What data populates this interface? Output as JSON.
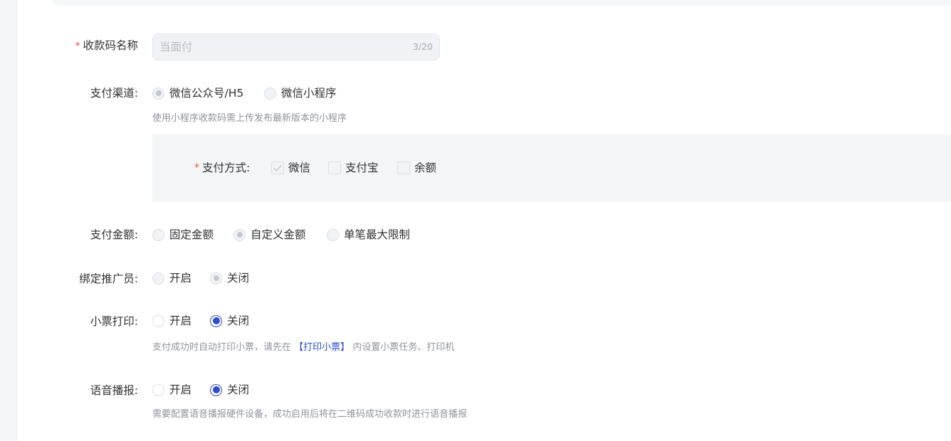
{
  "name_field": {
    "label": "收款码名称",
    "placeholder": "当面付",
    "counter": "3/20"
  },
  "pay_channel": {
    "label": "支付渠道:",
    "options": [
      "微信公众号/H5",
      "微信小程序"
    ],
    "selected": "微信公众号/H5",
    "hint": "使用小程序收款码需上传发布最新版本的小程序"
  },
  "pay_method": {
    "label": "支付方式:",
    "options": [
      {
        "label": "微信",
        "checked": true
      },
      {
        "label": "支付宝",
        "checked": false
      },
      {
        "label": "余额",
        "checked": false
      }
    ]
  },
  "pay_amount": {
    "label": "支付金额:",
    "options": [
      "固定金额",
      "自定义金额",
      "单笔最大限制"
    ],
    "selected": "自定义金额"
  },
  "bind_promoter": {
    "label": "绑定推广员:",
    "options": [
      "开启",
      "关闭"
    ],
    "selected": "关闭"
  },
  "receipt_print": {
    "label": "小票打印:",
    "options": [
      "开启",
      "关闭"
    ],
    "selected": "关闭",
    "hint_before": "支付成功时自动打印小票，请先在",
    "hint_link": "【打印小票】",
    "hint_after": "内设置小票任务、打印机"
  },
  "voice_broadcast": {
    "label": "语音播报:",
    "options": [
      "开启",
      "关闭"
    ],
    "selected": "关闭",
    "hint": "需要配置语音播报硬件设备，成功启用后将在二维码成功收款时进行语音播报"
  },
  "colors": {
    "accent": "#2d4bd6",
    "required": "#e4553b",
    "panel_bg": "#f4f5f7",
    "hint_text": "#909399"
  }
}
